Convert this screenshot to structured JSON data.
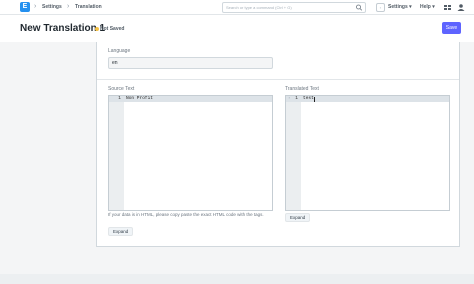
{
  "navbar": {
    "logo_letter": "E",
    "breadcrumbs": [
      "Settings",
      "Translation"
    ],
    "search_placeholder": "Search or type a command (Ctrl + G)",
    "settings_menu": "Settings",
    "help_menu": "Help",
    "settings_icon": "caret-down-icon",
    "help_icon": "caret-down-icon",
    "apps_icon": "grid-icon",
    "user_icon": "user-icon"
  },
  "page": {
    "title": "New Translation 1",
    "status": "Not Saved",
    "status_color": "#f6c244",
    "save_label": "Save",
    "primary_color": "#5e64ff"
  },
  "form": {
    "language_label": "Language",
    "language_value": "en",
    "source_label": "Source Text",
    "source_line_number": "1",
    "source_code": "Non Profit",
    "translated_label": "Translated Text",
    "translated_line_number": "1",
    "translated_code": "test",
    "help_text": "If your data is in HTML, please copy paste the exact HTML code with the tags.",
    "expand_label": "Expand"
  }
}
